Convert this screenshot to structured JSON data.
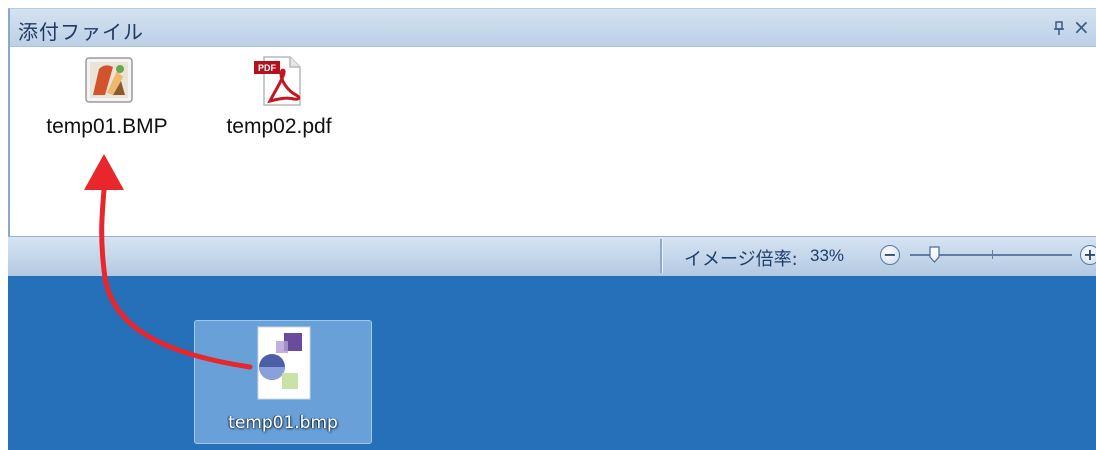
{
  "attachments_panel": {
    "title": "添付ファイル",
    "pin_icon": "pin-icon",
    "close_glyph": "×",
    "files": [
      {
        "name": "temp01.BMP",
        "icon": "bitmap-image-icon"
      },
      {
        "name": "temp02.pdf",
        "icon": "pdf-file-icon",
        "badge": "PDF"
      }
    ]
  },
  "status_bar": {
    "zoom_label": "イメージ倍率:",
    "zoom_value": "33%",
    "zoom_fraction": 0.33,
    "minus_glyph": "−",
    "plus_glyph": "+"
  },
  "desktop": {
    "icon_label": "temp01.bmp",
    "icon": "bitmap-image-icon",
    "background": "#2570b8"
  },
  "colors": {
    "arrow": "#e8262b",
    "panel_header": "#c9dbee",
    "desktop": "#2570b8"
  }
}
